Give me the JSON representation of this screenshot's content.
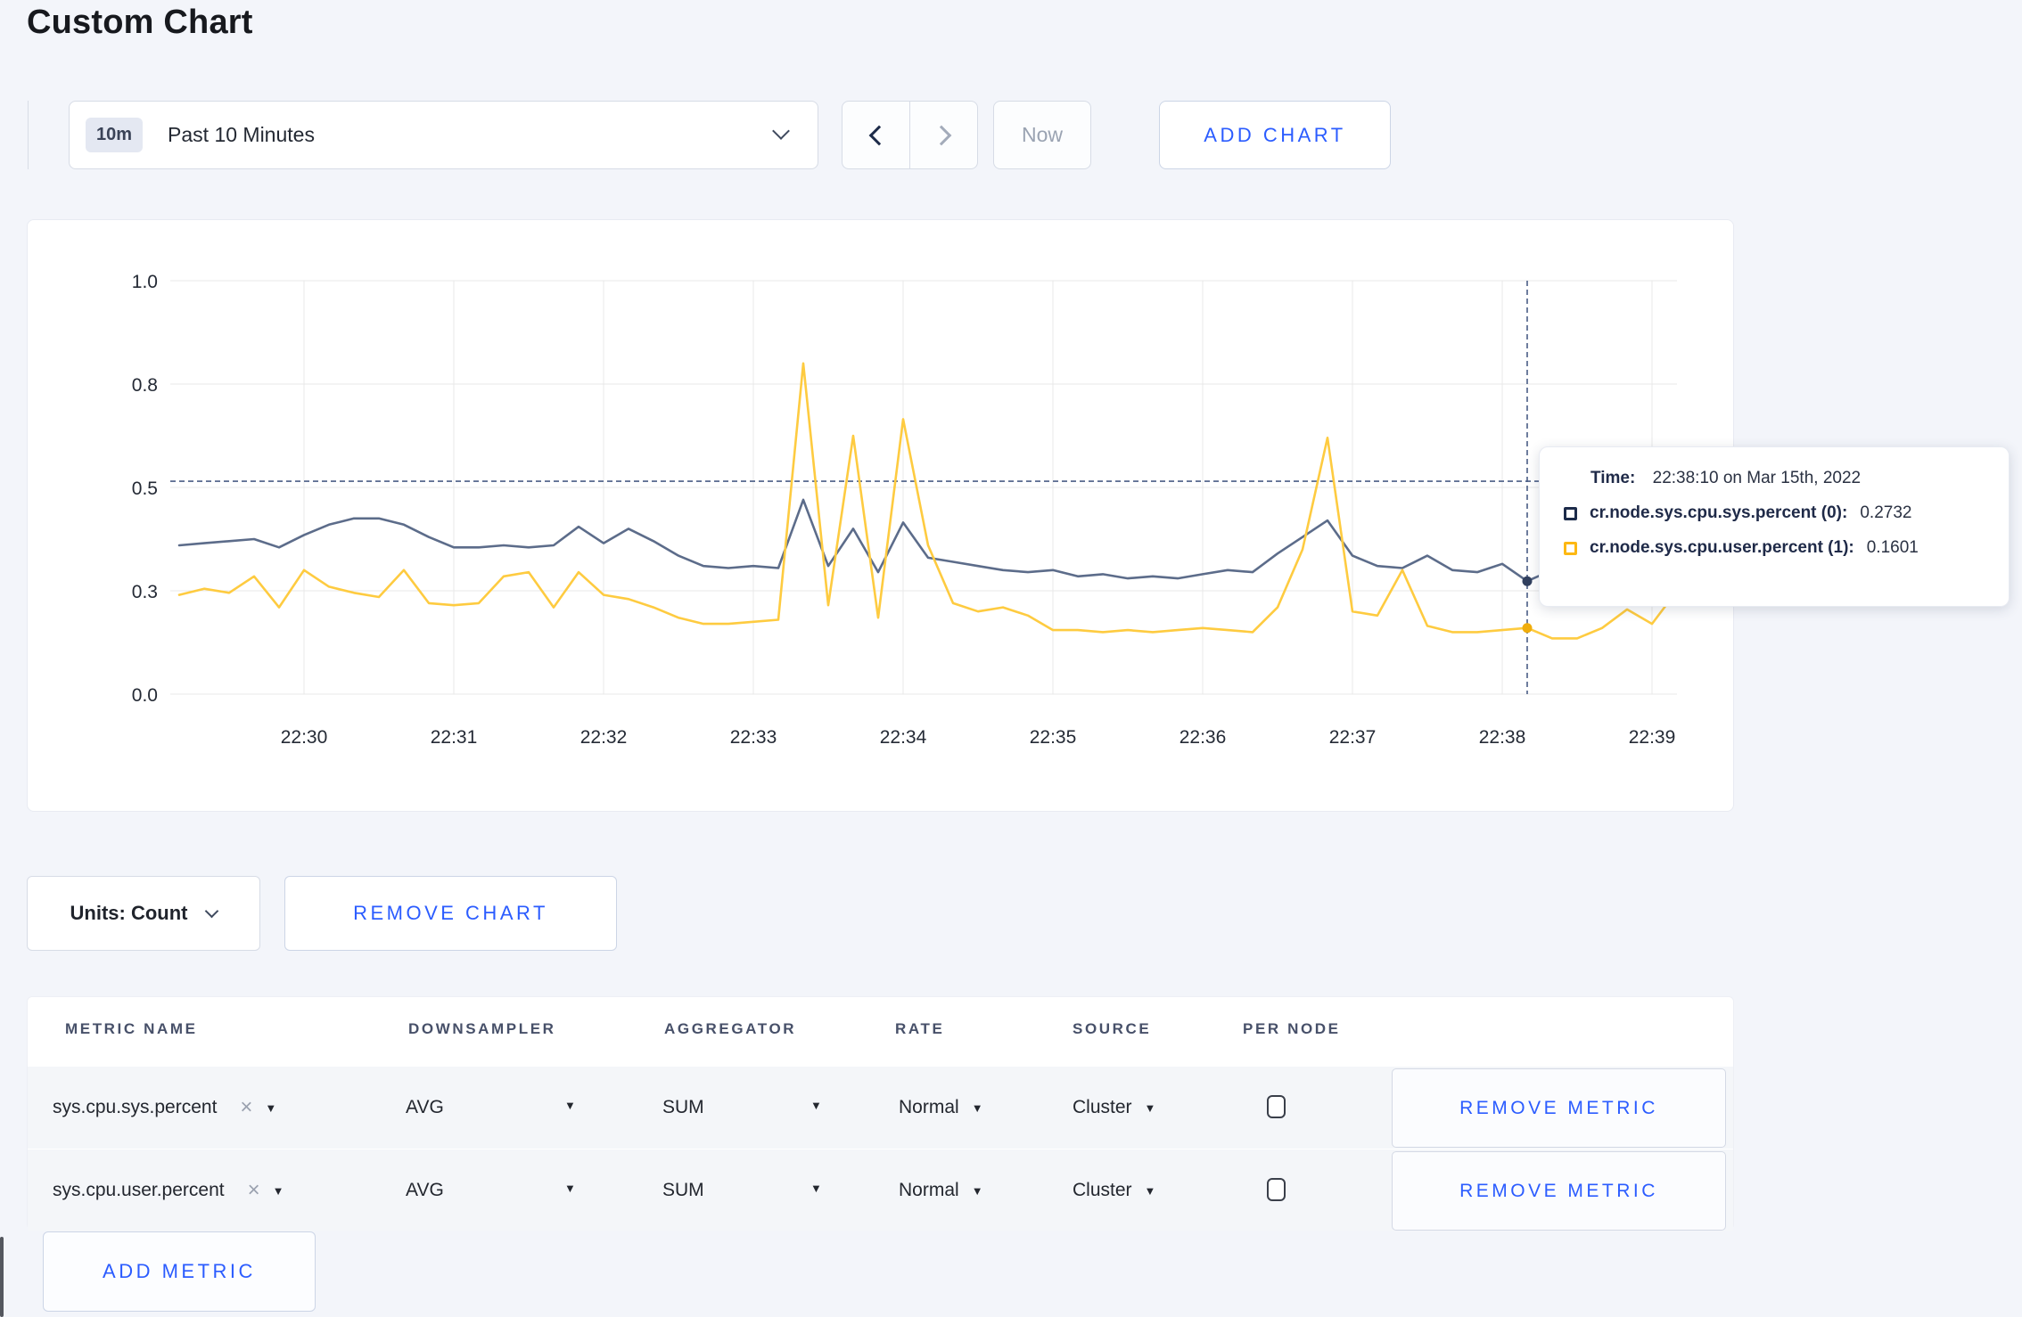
{
  "page": {
    "title": "Custom Chart",
    "accent_blue": "#2b5cff",
    "background": "#f3f5fa"
  },
  "toolbar": {
    "time_badge": "10m",
    "time_label": "Past 10 Minutes",
    "now_label": "Now",
    "add_chart_label": "ADD CHART"
  },
  "icons": {
    "clear": "×",
    "caret_down": "▼"
  },
  "chart_data": {
    "type": "line",
    "title": "",
    "xlabel": "",
    "ylabel": "",
    "ylim": [
      0,
      1.0
    ],
    "grid": true,
    "legend_position": "tooltip",
    "x_tick_labels": [
      "22:30",
      "22:31",
      "22:32",
      "22:33",
      "22:34",
      "22:35",
      "22:36",
      "22:37",
      "22:38",
      "22:39"
    ],
    "y_ticks": [
      {
        "value": 0.0,
        "label": "0.0"
      },
      {
        "value": 0.25,
        "label": "0.3"
      },
      {
        "value": 0.5,
        "label": "0.5"
      },
      {
        "value": 0.75,
        "label": "0.8"
      },
      {
        "value": 1.0,
        "label": "1.0"
      }
    ],
    "step_seconds": 10,
    "start_offset_steps": -5,
    "series": [
      {
        "name": "cr.node.sys.cpu.sys.percent",
        "color": "#5c6c8a",
        "dot_color": "#31405f",
        "values": [
          0.36,
          0.365,
          0.37,
          0.375,
          0.355,
          0.385,
          0.41,
          0.425,
          0.425,
          0.41,
          0.38,
          0.355,
          0.355,
          0.36,
          0.355,
          0.36,
          0.405,
          0.365,
          0.4,
          0.37,
          0.335,
          0.31,
          0.305,
          0.31,
          0.305,
          0.47,
          0.31,
          0.4,
          0.295,
          0.415,
          0.33,
          0.32,
          0.31,
          0.3,
          0.295,
          0.3,
          0.285,
          0.29,
          0.28,
          0.285,
          0.28,
          0.29,
          0.3,
          0.295,
          0.34,
          0.38,
          0.42,
          0.335,
          0.31,
          0.305,
          0.335,
          0.3,
          0.295,
          0.315,
          0.2732,
          0.3,
          0.31,
          0.3,
          0.31,
          0.32,
          0.315
        ]
      },
      {
        "name": "cr.node.sys.cpu.user.percent",
        "color": "#fecb40",
        "dot_color": "#f0ad0c",
        "values": [
          0.24,
          0.255,
          0.245,
          0.285,
          0.21,
          0.3,
          0.26,
          0.245,
          0.235,
          0.3,
          0.22,
          0.215,
          0.22,
          0.285,
          0.295,
          0.21,
          0.295,
          0.24,
          0.23,
          0.21,
          0.185,
          0.17,
          0.17,
          0.175,
          0.18,
          0.8,
          0.215,
          0.625,
          0.185,
          0.665,
          0.36,
          0.22,
          0.2,
          0.21,
          0.19,
          0.155,
          0.155,
          0.15,
          0.155,
          0.15,
          0.155,
          0.16,
          0.155,
          0.15,
          0.21,
          0.35,
          0.62,
          0.2,
          0.19,
          0.3,
          0.165,
          0.15,
          0.15,
          0.155,
          0.1601,
          0.135,
          0.135,
          0.16,
          0.205,
          0.17,
          0.25
        ]
      }
    ],
    "crosshair": {
      "index": 54,
      "hline_value": 0.515,
      "color": "#4a5d85"
    },
    "tooltip": {
      "time_label": "Time:",
      "time_value": "22:38:10 on Mar 15th, 2022",
      "rows": [
        {
          "label": "cr.node.sys.cpu.sys.percent (0):",
          "value": "0.2732",
          "swatch_color": "#1c2b4a"
        },
        {
          "label": "cr.node.sys.cpu.user.percent (1):",
          "value": "0.1601",
          "swatch_color": "#fdb813"
        }
      ]
    }
  },
  "chart_controls": {
    "units_label": "Units: Count",
    "remove_chart_label": "REMOVE CHART"
  },
  "metrics_table": {
    "headers": [
      "METRIC NAME",
      "DOWNSAMPLER",
      "AGGREGATOR",
      "RATE",
      "SOURCE",
      "PER NODE"
    ],
    "rows": [
      {
        "metric": "sys.cpu.sys.percent",
        "downsampler": "AVG",
        "aggregator": "SUM",
        "rate": "Normal",
        "source": "Cluster",
        "per_node_checked": false,
        "remove_label": "REMOVE METRIC"
      },
      {
        "metric": "sys.cpu.user.percent",
        "downsampler": "AVG",
        "aggregator": "SUM",
        "rate": "Normal",
        "source": "Cluster",
        "per_node_checked": false,
        "remove_label": "REMOVE METRIC"
      }
    ],
    "add_metric_label": "ADD METRIC"
  }
}
